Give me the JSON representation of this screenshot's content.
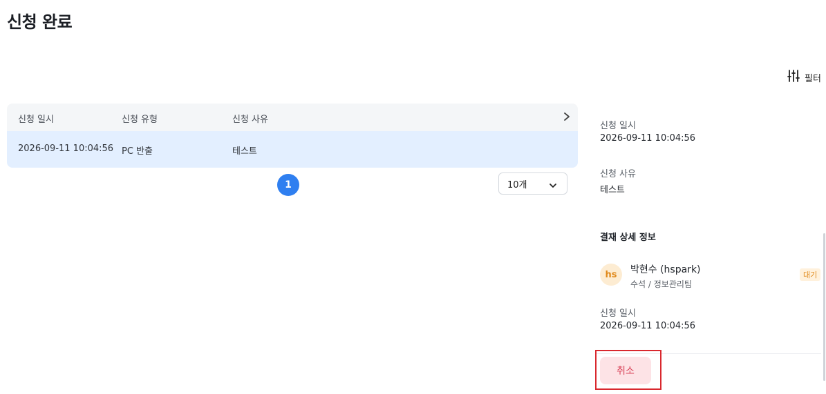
{
  "page": {
    "title": "신청 완료"
  },
  "filter": {
    "label": "필터",
    "icon": "sliders-icon"
  },
  "table": {
    "columns": [
      "신청 일시",
      "신청 유형",
      "신청 사유"
    ],
    "rows": [
      {
        "date": "2026-09-11 10:04:56",
        "type": "PC 반출",
        "reason": "테스트"
      }
    ]
  },
  "pagination": {
    "current": "1",
    "page_size": "10개"
  },
  "detail": {
    "request_date_label": "신청 일시",
    "request_date": "2026-09-11 10:04:56",
    "request_reason_label": "신청 사유",
    "request_reason": "테스트",
    "approval_heading": "결재 상세 정보",
    "approver": {
      "initials": "hs",
      "name": "박현수 (hspark)",
      "role": "수석 / 정보관리팀",
      "status": "대기"
    },
    "approval_date_label": "신청 일시",
    "approval_date": "2026-09-11 10:04:56",
    "cancel_label": "취소"
  },
  "colors": {
    "accent": "#2f7ff0",
    "selected_row": "#e3efff",
    "cancel_bg": "#fde3e6",
    "cancel_text": "#d9455b",
    "status_pending": "#e08a1c",
    "highlight": "#d9282e"
  }
}
